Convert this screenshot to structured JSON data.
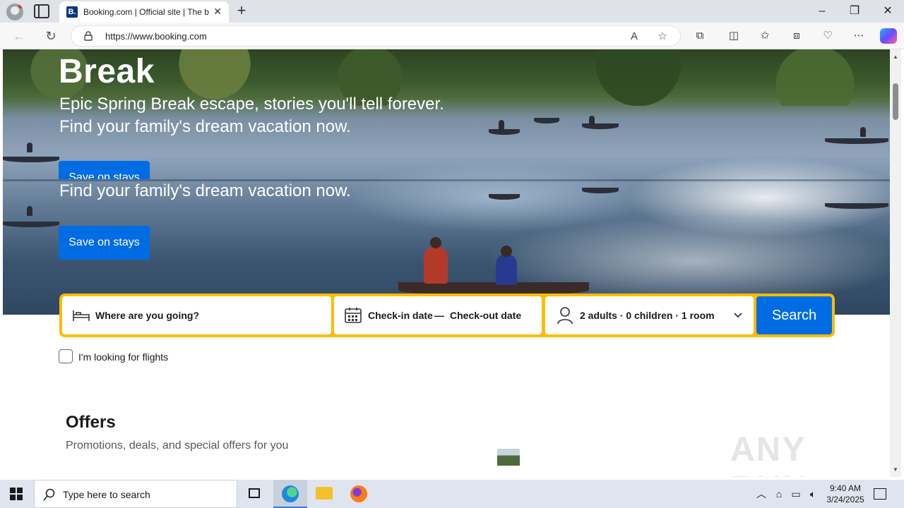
{
  "browser": {
    "tab_title": "Booking.com | Official site | The b",
    "tab_favicon": "B.",
    "url": "https://www.booking.com"
  },
  "hero": {
    "title": "Break",
    "subtitle_line1": "Epic Spring Break escape, stories you'll tell forever.",
    "subtitle_line2": "Find your family's dream vacation now.",
    "cta_label": "Save on stays"
  },
  "search": {
    "destination_placeholder": "Where are you going?",
    "checkin_label": "Check-in date",
    "date_separator": "—",
    "checkout_label": "Check-out date",
    "occupancy": "2 adults · 0 children · 1 room",
    "button_label": "Search"
  },
  "flights": {
    "checkbox_label": "I'm looking for flights",
    "checked": false
  },
  "offers": {
    "title": "Offers",
    "subtitle": "Promotions, deals, and special offers for you"
  },
  "watermark": "ANY RUN",
  "taskbar": {
    "search_placeholder": "Type here to search",
    "time": "9:40 AM",
    "date": "3/24/2025"
  },
  "colors": {
    "brand_blue": "#006ce4",
    "search_border": "#febb02",
    "favicon_bg": "#003580"
  }
}
